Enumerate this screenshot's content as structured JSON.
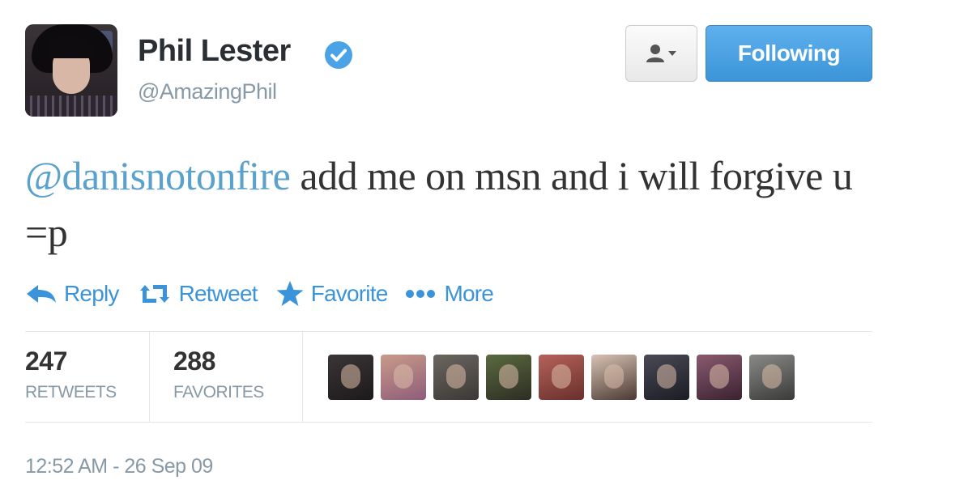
{
  "tweet": {
    "author_name": "Phil Lester",
    "handle": "@AmazingPhil",
    "verified": true,
    "mention": "@danisnotonfire",
    "text": " add me on msn and i will forgive u =p",
    "timestamp": "12:52 AM - 26 Sep 09"
  },
  "header": {
    "user_menu_icon": "user-dropdown-icon",
    "follow_label": "Following"
  },
  "actions": {
    "reply": "Reply",
    "retweet": "Retweet",
    "favorite": "Favorite",
    "more": "More"
  },
  "stats": {
    "retweets_count": "247",
    "retweets_label": "RETWEETS",
    "favorites_count": "288",
    "favorites_label": "FAVORITES"
  },
  "favoriters": [
    {
      "colors": [
        "#3a3536",
        "#1d1a1b"
      ]
    },
    {
      "colors": [
        "#c89b8a",
        "#8f5c7a"
      ]
    },
    {
      "colors": [
        "#6b6660",
        "#3c3835"
      ]
    },
    {
      "colors": [
        "#5a6a40",
        "#2d2d23"
      ]
    },
    {
      "colors": [
        "#b5625a",
        "#6a2f2c"
      ]
    },
    {
      "colors": [
        "#d8c2b4",
        "#4b3a33"
      ]
    },
    {
      "colors": [
        "#4a4a55",
        "#1c1c25"
      ]
    },
    {
      "colors": [
        "#8a5a70",
        "#3a2230"
      ]
    },
    {
      "colors": [
        "#8a8a88",
        "#3a3a38"
      ]
    }
  ],
  "colors": {
    "link": "#3b94d9",
    "button_blue": "#4aa3e6"
  }
}
